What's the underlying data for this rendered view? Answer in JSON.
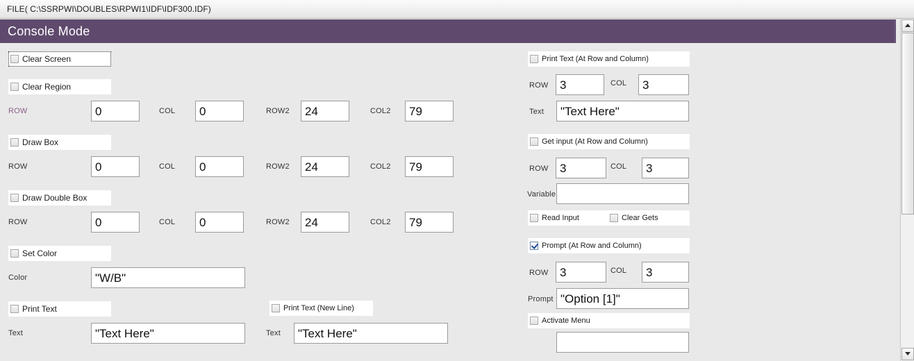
{
  "window": {
    "file_path_label": "FILE( C:\\SSRPWI\\DOUBLES\\RPWI1\\IDF\\IDF300.IDF)",
    "header_title": "Console Mode",
    "accent_color": "#5f4a6e",
    "panel_background": "#e9e9e9",
    "label_accent_color": "#8b5f88"
  },
  "scrollbar": {
    "up_arrow": "scroll-up-arrow-icon",
    "down_arrow": "scroll-down-arrow-icon",
    "thumb": "scroll-thumb"
  },
  "left_column": {
    "clear_screen": {
      "checkbox_label": "Clear Screen",
      "checked": false,
      "focused": true
    },
    "clear_region": {
      "checkbox_label": "Clear Region",
      "checked": false,
      "fields": [
        {
          "label": "ROW",
          "value": "0",
          "accent": true
        },
        {
          "label": "COL",
          "value": "0",
          "accent": false
        },
        {
          "label": "ROW2",
          "value": "24",
          "accent": false
        },
        {
          "label": "COL2",
          "value": "79",
          "accent": false
        }
      ]
    },
    "draw_box": {
      "checkbox_label": "Draw Box",
      "checked": false,
      "fields": [
        {
          "label": "ROW",
          "value": "0",
          "accent": false
        },
        {
          "label": "COL",
          "value": "0",
          "accent": false
        },
        {
          "label": "ROW2",
          "value": "24",
          "accent": false
        },
        {
          "label": "COL2",
          "value": "79",
          "accent": false
        }
      ]
    },
    "draw_double_box": {
      "checkbox_label": "Draw Double Box",
      "checked": false,
      "fields": [
        {
          "label": "ROW",
          "value": "0",
          "accent": false
        },
        {
          "label": "COL",
          "value": "0",
          "accent": false
        },
        {
          "label": "ROW2",
          "value": "24",
          "accent": false
        },
        {
          "label": "COL2",
          "value": "79",
          "accent": false
        }
      ]
    },
    "set_color": {
      "checkbox_label": "Set Color",
      "checked": false,
      "color_field_label": "Color",
      "color_value": "\"W/B\""
    },
    "print_text": {
      "checkbox_label": "Print Text",
      "checked": false,
      "text_field_label": "Text",
      "text_value": "\"Text Here\""
    },
    "print_text_new_line": {
      "checkbox_label": "Print Text (New Line)",
      "checked": false,
      "text_field_label": "Text",
      "text_value": "\"Text Here\""
    }
  },
  "right_column": {
    "print_text_at": {
      "checkbox_label": "Print Text (At Row and Column)",
      "checked": false,
      "row_label": "ROW",
      "row_value": "3",
      "col_label": "COL",
      "col_value": "3",
      "text_field_label": "Text",
      "text_value": "\"Text Here\""
    },
    "get_input_at": {
      "checkbox_label": "Get input (At Row and Column)",
      "checked": false,
      "row_label": "ROW",
      "row_value": "3",
      "col_label": "COL",
      "col_value": "3",
      "variable_field_label": "Variable",
      "variable_value": ""
    },
    "read_input": {
      "checkbox_label": "Read Input",
      "checked": false
    },
    "clear_gets": {
      "checkbox_label": "Clear Gets",
      "checked": false
    },
    "prompt_at": {
      "checkbox_label": "Prompt (At Row and Column)",
      "checked": true,
      "row_label": "ROW",
      "row_value": "3",
      "col_label": "COL",
      "col_value": "3",
      "prompt_field_label": "Prompt",
      "prompt_value": "\"Option [1]\""
    },
    "activate_menu": {
      "checkbox_label": "Activate Menu",
      "checked": false,
      "menu_value": ""
    }
  }
}
